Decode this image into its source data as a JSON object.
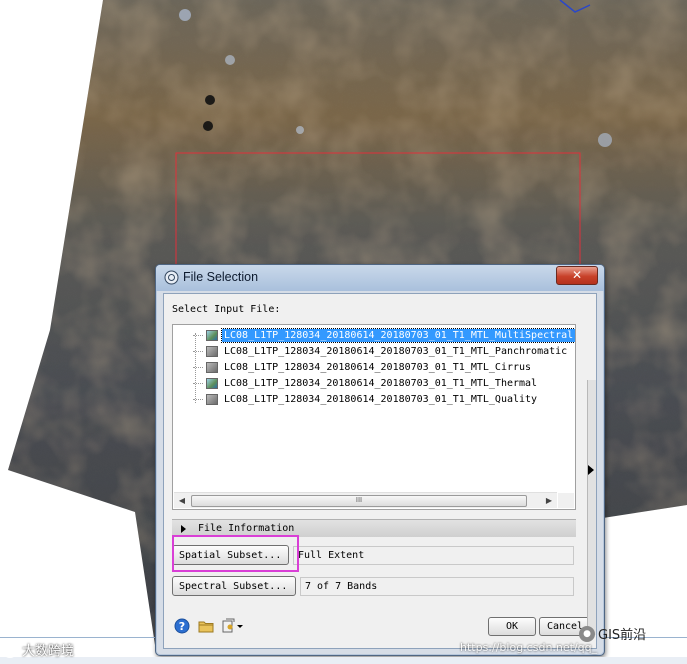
{
  "dialog": {
    "title": "File Selection",
    "close_label": "✕",
    "select_label": "Select Input File:",
    "files": [
      {
        "name": "LC08_L1TP_128034_20180614_20180703_01_T1_MTL_MultiSpectral",
        "selected": true,
        "icon": "color-raster-icon"
      },
      {
        "name": "LC08_L1TP_128034_20180614_20180703_01_T1_MTL_Panchromatic",
        "selected": false,
        "icon": "gray-raster-icon"
      },
      {
        "name": "LC08_L1TP_128034_20180614_20180703_01_T1_MTL_Cirrus",
        "selected": false,
        "icon": "gray-raster-icon"
      },
      {
        "name": "LC08_L1TP_128034_20180614_20180703_01_T1_MTL_Thermal",
        "selected": false,
        "icon": "color-raster-icon"
      },
      {
        "name": "LC08_L1TP_128034_20180614_20180703_01_T1_MTL_Quality",
        "selected": false,
        "icon": "gray-raster-icon"
      }
    ],
    "scroll_left": "◀",
    "scroll_right": "▶",
    "scroll_thumb": "III",
    "file_info_label": "File Information",
    "spatial_subset_label": "Spatial Subset...",
    "spatial_subset_value": "Full Extent",
    "spectral_subset_label": "Spectral Subset...",
    "spectral_subset_value": "7 of 7 Bands",
    "ok_label": "OK",
    "cancel_label": "Cancel"
  },
  "watermarks": {
    "left": "大数跨境",
    "right": "GIS前沿",
    "url": "https://blog.csdn.net/qq_"
  },
  "colors": {
    "selection": "#3399ff",
    "highlight_box": "#d93fd6",
    "roi_box": "#e0303a"
  }
}
